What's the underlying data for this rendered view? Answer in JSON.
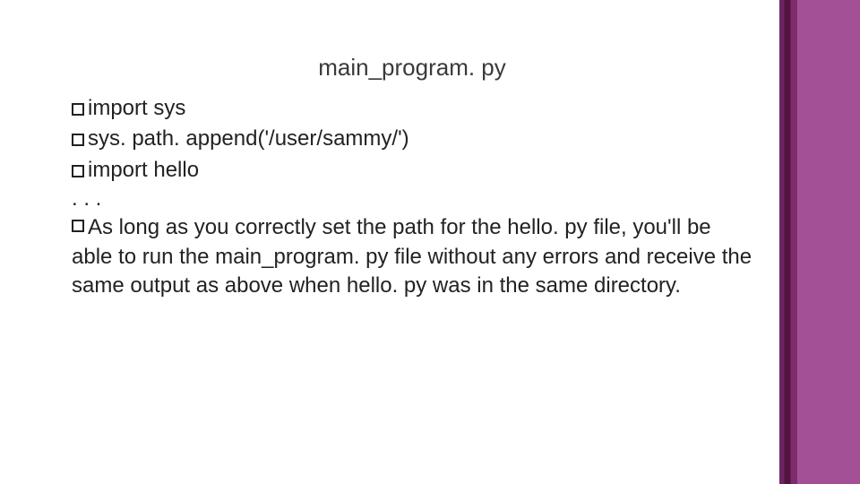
{
  "title": "main_program. py",
  "lines": {
    "l1": "import sys",
    "l2": "sys. path. append('/user/sammy/')",
    "l3": "import hello"
  },
  "ellipsis": ". . .",
  "para_lead": "As",
  "para_rest": " long as you correctly set the path for the hello. py file, you'll be able to run the main_program. py file without any errors and receive the same output as above when hello. py was in the same directory."
}
